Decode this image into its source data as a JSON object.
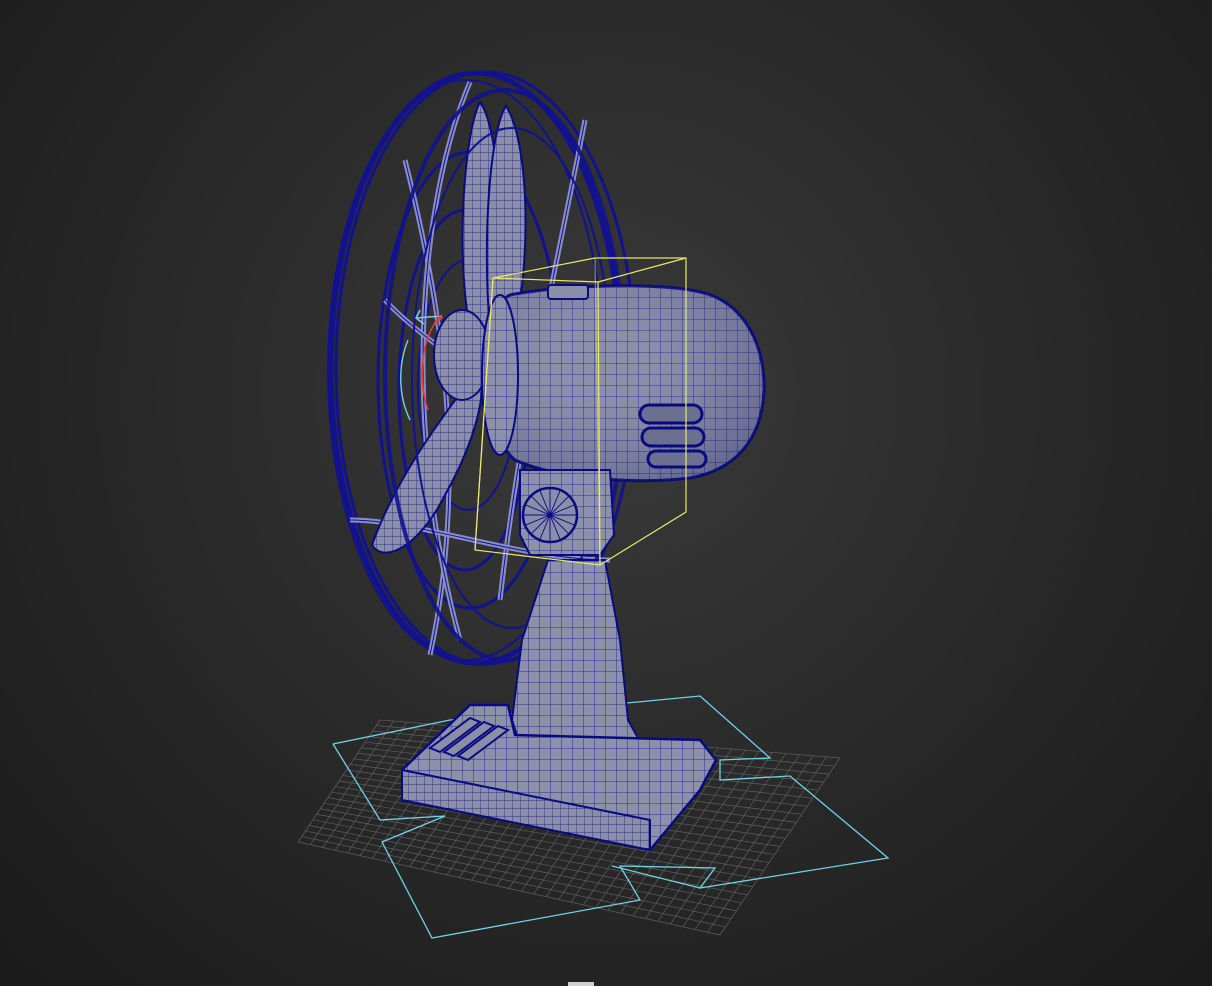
{
  "viewport": {
    "background": "#2b2b2b",
    "mesh_color": "#8a8ea8",
    "wireframe_color": "#0c0c8c",
    "selection_box_color": "#e8e86a",
    "rotate_manipulator_colors": [
      "#e23b3b",
      "#6fd3e6"
    ],
    "grid_color": "#5f5f5f",
    "guide_color": "#6fd3e6"
  },
  "scene": {
    "object_icons": [
      "fan-blade-icon",
      "fan-cage-icon",
      "motor-housing-icon",
      "stand-icon",
      "base-icon"
    ]
  }
}
